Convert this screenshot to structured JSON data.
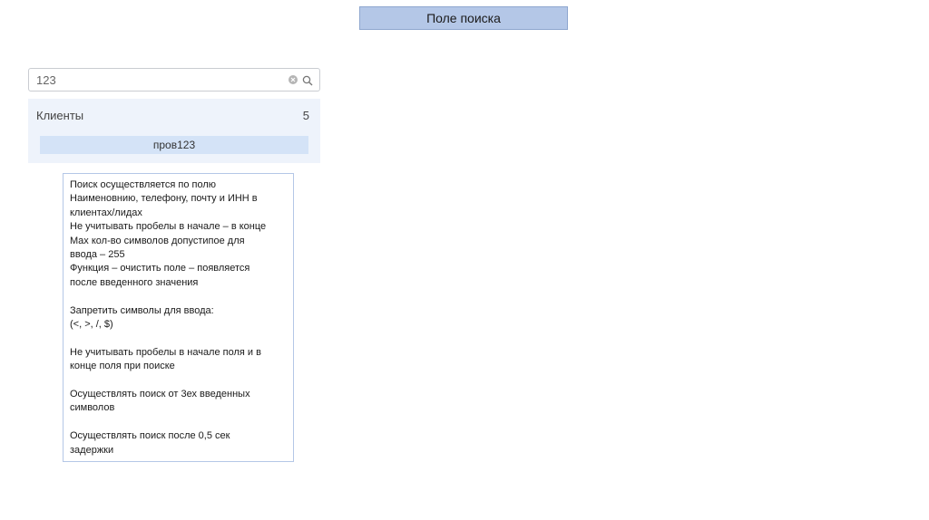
{
  "title": "Поле поиска",
  "search": {
    "value": "123"
  },
  "results": {
    "group_label": "Клиенты",
    "count": "5",
    "items": [
      {
        "label": "пров123"
      }
    ]
  },
  "notes": {
    "paragraphs": [
      "Поиск осуществляется по полю\nНаименовнию, телефону, почту и ИНН в\nклиентах/лидах\nНе учитывать пробелы в начале – в конце\nMax кол-во символов допустипое для\nввода – 255\nФункция – очистить поле – появляется\nпосле введенного значения",
      "Запретить символы для ввода:\n(<, >, /, $)",
      "Не учитывать пробелы в начале поля и в\nконце поля при поиске",
      "Осуществлять поиск от 3ех введенных\nсимволов",
      "Осуществлять поиск после 0,5 сек\nзадержки"
    ]
  },
  "icons": {
    "clear": "clear-icon",
    "search": "search-icon"
  },
  "colors": {
    "title_fill": "#b4c7e7",
    "results_bg": "#eef3fb",
    "item_bg": "#d4e3f7"
  }
}
